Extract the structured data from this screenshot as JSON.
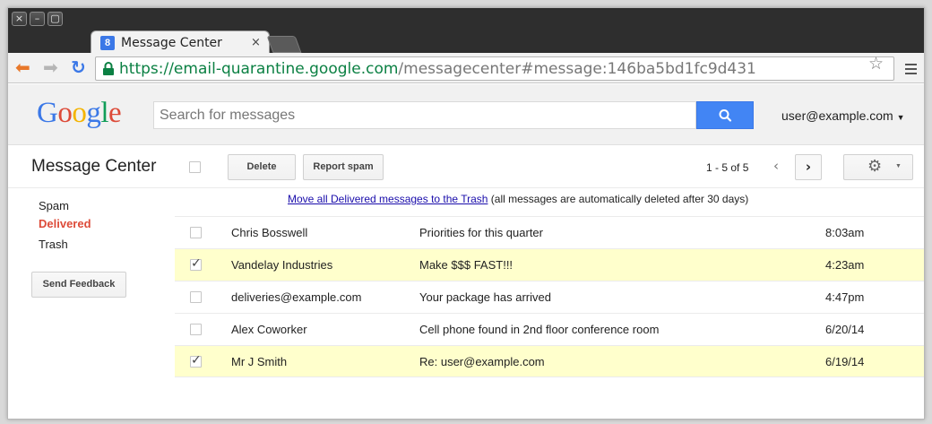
{
  "browser": {
    "window_buttons": [
      "×",
      "–",
      "▢"
    ],
    "tab": {
      "favicon": "8",
      "title": "Message Center",
      "close": "×"
    },
    "url": {
      "secure_part": "https://email-quarantine.google.com",
      "rest": "/messagecenter#message:146ba5bd1fc9d431"
    },
    "icons": [
      "back-arrow-icon",
      "forward-arrow-icon",
      "reload-icon",
      "lock-icon",
      "star-icon",
      "menu-icon"
    ]
  },
  "header": {
    "logo_letters": [
      "G",
      "o",
      "o",
      "g",
      "l",
      "e"
    ],
    "logo_colors": [
      "#3b78e7",
      "#dd4b39",
      "#f4b400",
      "#3b78e7",
      "#0f9d58",
      "#dd4b39"
    ],
    "search_placeholder": "Search for messages",
    "search_value": "",
    "account": "user@example.com"
  },
  "toolbar": {
    "page_title": "Message Center",
    "delete_label": "Delete",
    "report_spam_label": "Report spam",
    "pager": "1 - 5 of 5",
    "prev": "‹",
    "next": "›"
  },
  "sidebar": {
    "items": [
      "Spam",
      "Delivered",
      "Trash"
    ],
    "active": "Delivered",
    "feedback_label": "Send Feedback"
  },
  "notice": {
    "link": "Move all Delivered messages to the Trash",
    "text": " (all messages are automatically deleted after 30 days)"
  },
  "messages": [
    {
      "from": "Chris Bosswell",
      "subject": "Priorities for this quarter",
      "time": "8:03am",
      "checked": false
    },
    {
      "from": "Vandelay Industries",
      "subject": "Make $$$ FAST!!!",
      "time": "4:23am",
      "checked": true
    },
    {
      "from": "deliveries@example.com",
      "subject": "Your package has arrived",
      "time": "4:47pm",
      "checked": false
    },
    {
      "from": "Alex Coworker",
      "subject": "Cell phone found in 2nd floor conference room",
      "time": "6/20/14",
      "checked": false
    },
    {
      "from": "Mr J Smith",
      "subject": "Re: user@example.com",
      "time": "6/19/14",
      "checked": true
    }
  ],
  "colors": {
    "accent": "#4285f4",
    "active": "#dd4b39",
    "selected_row": "#ffffcc"
  }
}
